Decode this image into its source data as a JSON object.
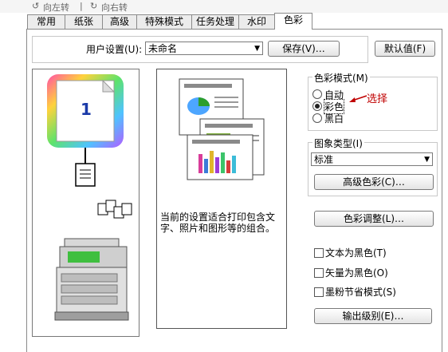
{
  "toolbar": {
    "rotate_left": "向左转",
    "rotate_right": "向右转"
  },
  "tabs": [
    "常用",
    "纸张",
    "高级",
    "特殊模式",
    "任务处理",
    "水印",
    "色彩"
  ],
  "user_settings": {
    "label": "用户设置(U):",
    "value": "未命名",
    "save": "保存(V)…",
    "default": "默认值(F)"
  },
  "preview": {
    "page_number": "1"
  },
  "description": "当前的设置适合打印包含文字、照片和图形等的组合。",
  "color_mode": {
    "label": "色彩模式(M)",
    "options": [
      "自动",
      "彩色",
      "黑白"
    ],
    "selected": "彩色",
    "annotation": "选择"
  },
  "image_type": {
    "label": "图象类型(I)",
    "value": "标准",
    "advanced": "高级色彩(C)…"
  },
  "color_adjust": "色彩调整(L)…",
  "checkboxes": [
    "文本为黑色(T)",
    "矢量为黑色(O)",
    "墨粉节省模式(S)"
  ],
  "output_level": "输出级别(E)…"
}
